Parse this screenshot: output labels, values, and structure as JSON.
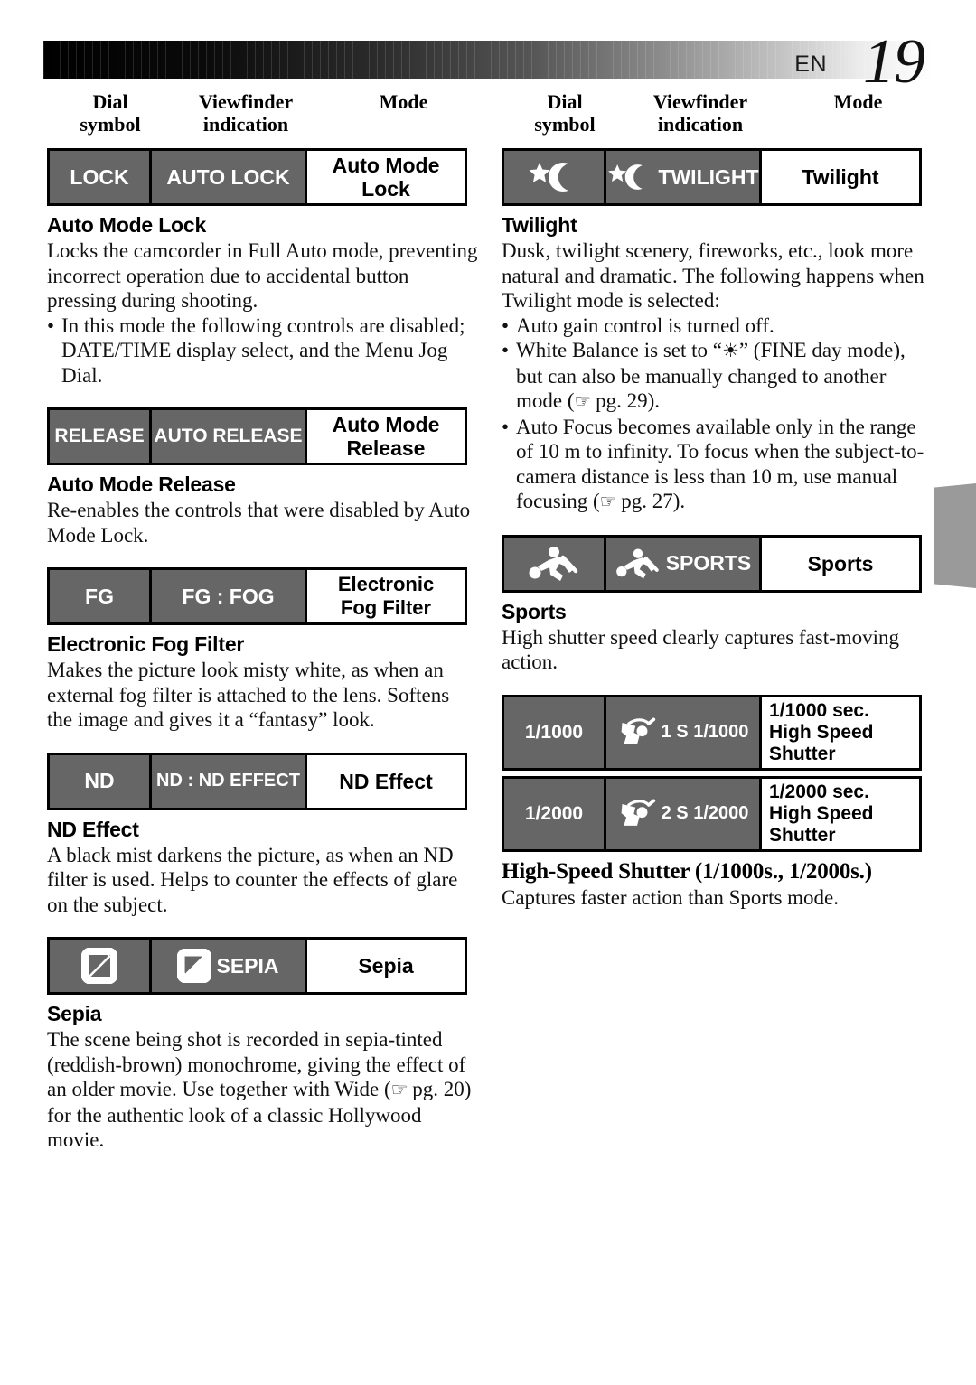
{
  "header": {
    "lang_label": "EN",
    "page_number": "19"
  },
  "column_headers": {
    "dial": "Dial\nsymbol",
    "dial_line1": "Dial",
    "dial_line2": "symbol",
    "viewfinder_line1": "Viewfinder",
    "viewfinder_line2": "indication",
    "mode": "Mode"
  },
  "left_column": {
    "rows": [
      {
        "dial_symbol": "LOCK",
        "viewfinder": "AUTO LOCK",
        "mode": "Auto Mode Lock"
      },
      {
        "dial_symbol": "RELEASE",
        "viewfinder": "AUTO RELEASE",
        "mode": "Auto Mode Release"
      },
      {
        "dial_symbol": "FG",
        "viewfinder": "FG : FOG",
        "mode_line1": "Electronic",
        "mode_line2": "Fog Filter"
      },
      {
        "dial_symbol": "ND",
        "viewfinder": "ND : ND EFFECT",
        "mode": "ND Effect"
      },
      {
        "dial_symbol_icon": "sepia-diagonal-icon",
        "viewfinder_icon": "sepia-diagonal-icon",
        "viewfinder": "SEPIA",
        "mode": "Sepia"
      }
    ],
    "sections": [
      {
        "title": "Auto Mode Lock",
        "body": "Locks the camcorder in Full Auto mode, preventing incorrect operation due to accidental button pressing during shooting.",
        "bullets": [
          "In this mode the following controls are disabled; DATE/TIME display select, and the Menu Jog Dial."
        ]
      },
      {
        "title": "Auto Mode Release",
        "body": "Re-enables the controls that were disabled by Auto Mode Lock."
      },
      {
        "title": "Electronic Fog Filter",
        "body": "Makes the picture look misty white, as when an external fog filter is attached to the lens. Softens the image and gives it a “fantasy” look."
      },
      {
        "title": "ND Effect",
        "body": "A black mist darkens the picture, as when an ND filter is used. Helps to counter the effects of glare on the subject."
      },
      {
        "title": "Sepia",
        "body_part1": "The scene being shot is recorded in sepia-tinted (reddish-brown) monochrome, giving the effect of an older movie. Use together with Wide (",
        "body_ref": " pg. 20)",
        "body_part2": " for the authentic look of a classic Hollywood movie."
      }
    ]
  },
  "right_column": {
    "rows": [
      {
        "dial_symbol_icon": "star-moon-icon",
        "viewfinder_icon": "star-moon-icon",
        "viewfinder": "TWILIGHT",
        "mode": "Twilight"
      },
      {
        "dial_symbol_icon": "running-person-icon",
        "viewfinder_icon": "running-person-icon",
        "viewfinder": "SPORTS",
        "mode": "Sports"
      },
      {
        "dial_symbol": "1/1000",
        "viewfinder_icon": "golfer-icon",
        "viewfinder": "1 S 1/1000",
        "mode_line1": "1/1000 sec.",
        "mode_line2": "High Speed Shutter"
      },
      {
        "dial_symbol": "1/2000",
        "viewfinder_icon": "golfer-icon",
        "viewfinder": "2 S 1/2000",
        "mode_line1": "1/2000 sec.",
        "mode_line2": "High Speed Shutter"
      }
    ],
    "sections": [
      {
        "title": "Twilight",
        "body": "Dusk, twilight scenery, fireworks, etc., look more natural and dramatic. The following happens when Twilight mode is selected:",
        "bullet1": "Auto gain control is turned off.",
        "bullet2_part1": "White Balance is set to “",
        "bullet2_symbol": "sun-icon",
        "bullet2_part2": "” (FINE day mode), but can also be manually changed to another mode (",
        "bullet2_ref": " pg. 29).",
        "bullet3_part1": "Auto Focus becomes available only in the range of 10 m to infinity. To focus when the subject-to-camera distance is less than 10 m, use manual focusing (",
        "bullet3_ref": " pg. 27)."
      },
      {
        "title": "Sports",
        "body": "High shutter speed clearly captures fast-moving action."
      },
      {
        "title": "High-Speed Shutter (1/1000s., 1/2000s.)",
        "body": "Captures faster action than Sports mode."
      }
    ]
  },
  "colors": {
    "cell_gray": "#666666",
    "side_tab_gray": "#9a9a9a",
    "border_black": "#000000"
  }
}
